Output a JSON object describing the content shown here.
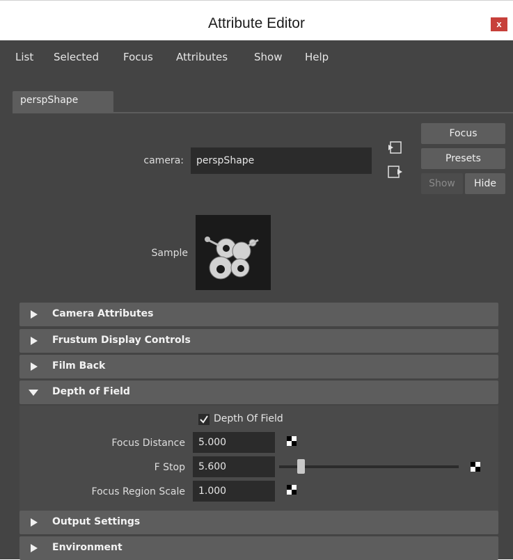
{
  "window": {
    "title": "Attribute Editor",
    "close_label": "x"
  },
  "menu": {
    "items": [
      {
        "label": "List"
      },
      {
        "label": "Selected"
      },
      {
        "label": "Focus"
      },
      {
        "label": "Attributes"
      },
      {
        "label": "Show"
      },
      {
        "label": "Help"
      }
    ]
  },
  "tab": {
    "label": "perspShape"
  },
  "node": {
    "type_label": "camera:",
    "name_value": "perspShape",
    "focus_button": "Focus",
    "presets_button": "Presets",
    "show_button": "Show",
    "hide_button": "Hide"
  },
  "sample": {
    "label": "Sample"
  },
  "sections": {
    "camera_attributes": "Camera Attributes",
    "frustum_display_controls": "Frustum Display Controls",
    "film_back": "Film Back",
    "depth_of_field": "Depth of Field",
    "output_settings": "Output Settings",
    "environment": "Environment"
  },
  "dof": {
    "checkbox_label": "Depth Of Field",
    "checkbox_checked": true,
    "focus_distance_label": "Focus Distance",
    "focus_distance_value": "5.000",
    "f_stop_label": "F Stop",
    "f_stop_value": "5.600",
    "f_stop_slider_fraction": 0.1,
    "focus_region_scale_label": "Focus Region Scale",
    "focus_region_scale_value": "1.000"
  },
  "colors": {
    "background": "#444444",
    "section_header": "#5d5d5d",
    "field": "#2b2b2b",
    "close_button": "#c7403a"
  }
}
